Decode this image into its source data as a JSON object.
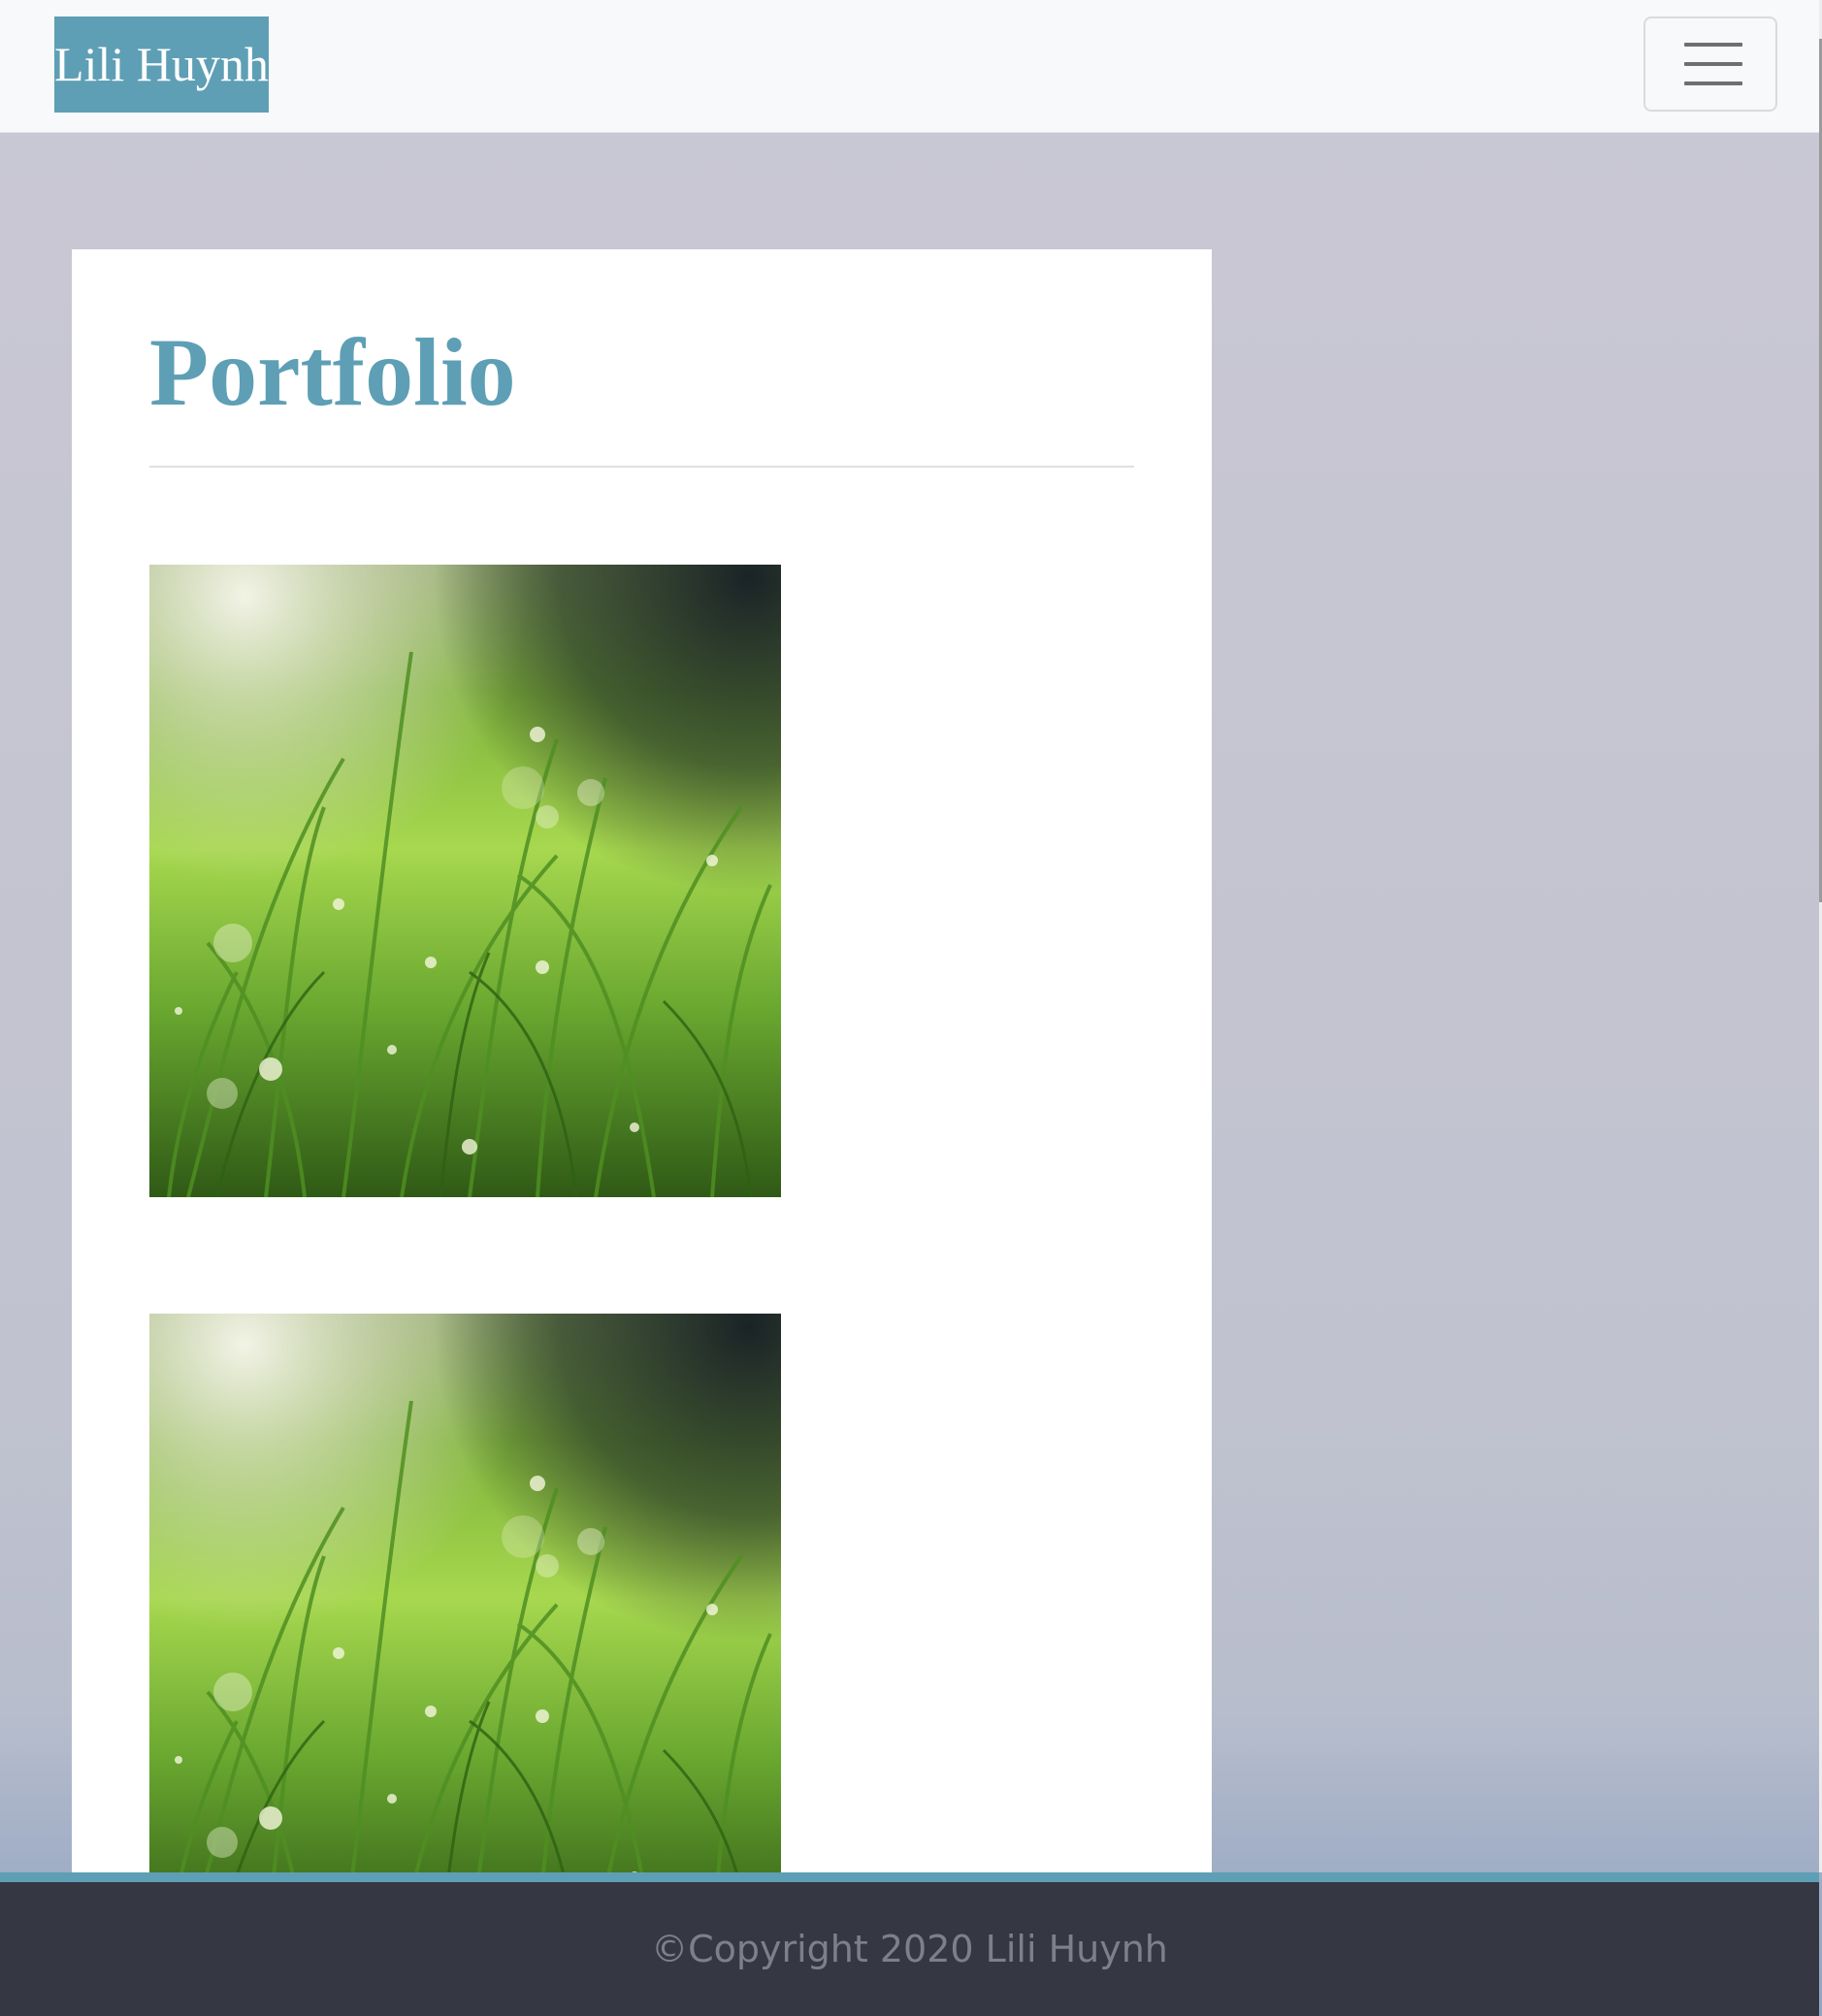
{
  "navbar": {
    "brand": "Lili Huynh",
    "toggle_icon": "hamburger-menu-icon"
  },
  "main": {
    "title": "Portfolio",
    "images": [
      {
        "subject": "dew-covered green grass"
      },
      {
        "subject": "dew-covered green grass"
      }
    ]
  },
  "footer": {
    "copyright": "©Copyright 2020 Lili Huynh"
  },
  "colors": {
    "accent": "#5e9fb5",
    "navbar_bg": "#f8f9fa",
    "footer_bg": "#353843",
    "footer_text": "#7d808a"
  }
}
